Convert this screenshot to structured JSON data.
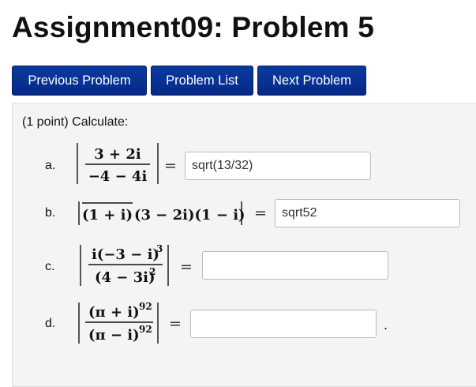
{
  "header": {
    "title": "Assignment09: Problem 5"
  },
  "nav": {
    "previous": "Previous Problem",
    "list": "Problem List",
    "next": "Next Problem"
  },
  "problem": {
    "intro": "(1 point) Calculate:",
    "equals": "=",
    "parts": [
      {
        "label": "a.",
        "num": "3 + 2i",
        "den": "−4 − 4i",
        "answer": "sqrt(13/32)"
      },
      {
        "label": "b.",
        "expr_bar": "(1 + i)",
        "expr_rest": "(3 − 2i)(1 − i)",
        "answer": "sqrt52"
      },
      {
        "label": "c.",
        "num": "i(−3 − i)",
        "num_exp": "3",
        "den": "(4 − 3i)",
        "den_exp": "2",
        "answer": ""
      },
      {
        "label": "d.",
        "num": "(π + i)",
        "num_exp": "92",
        "den": "(π − i)",
        "den_exp": "92",
        "answer": "",
        "trailing": "."
      }
    ]
  }
}
